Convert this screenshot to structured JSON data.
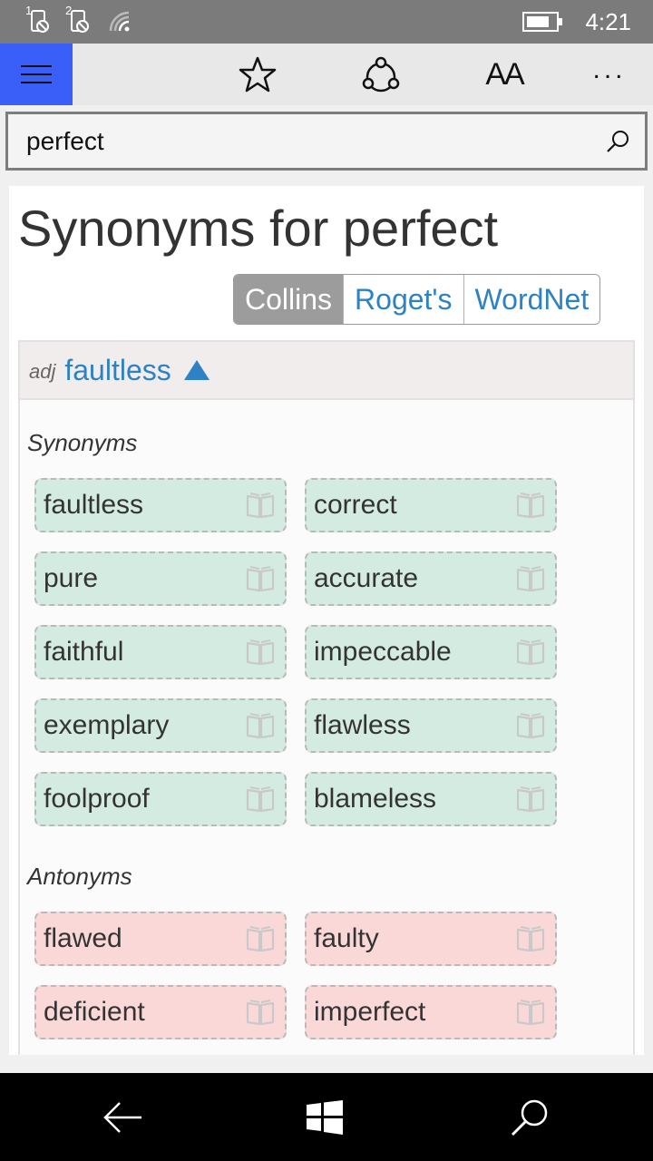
{
  "status_bar": {
    "sim1_label": "1",
    "sim2_label": "2",
    "battery_level": 0.8,
    "time": "4:21"
  },
  "app_bar": {
    "menu_icon": "hamburger-icon",
    "favorite_icon": "star-icon",
    "share_icon": "share-icon",
    "font_size_label": "AA",
    "more_label": "..."
  },
  "search": {
    "value": "perfect",
    "icon": "search-icon"
  },
  "page": {
    "title": "Synonyms for perfect"
  },
  "source_tabs": [
    {
      "label": "Collins",
      "active": true
    },
    {
      "label": "Roget's",
      "active": false
    },
    {
      "label": "WordNet",
      "active": false
    }
  ],
  "sense": {
    "part_of_speech": "adj",
    "word": "faultless",
    "synonyms_label": "Synonyms",
    "synonyms": [
      "faultless",
      "correct",
      "pure",
      "accurate",
      "faithful",
      "impeccable",
      "exemplary",
      "flawless",
      "foolproof",
      "blameless"
    ],
    "antonyms_label": "Antonyms",
    "antonyms": [
      "flawed",
      "faulty",
      "deficient",
      "imperfect"
    ],
    "chip_icon": "book-icon",
    "colors": {
      "synonym_bg": "#d4ebe2",
      "antonym_bg": "#fbd8d8",
      "link": "#2d82c5",
      "accent": "#3a5ff8"
    }
  },
  "nav_bar": {
    "back_icon": "back-arrow-icon",
    "home_icon": "windows-icon",
    "search_icon": "search-icon"
  }
}
